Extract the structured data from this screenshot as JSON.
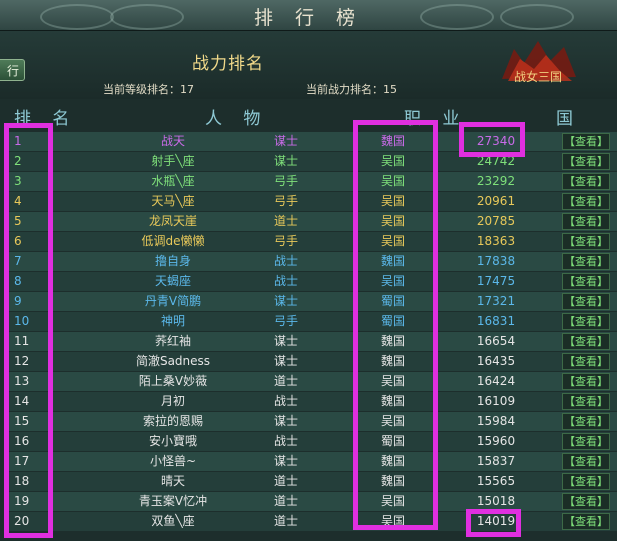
{
  "window": {
    "title": "排 行 榜",
    "side_button": "行"
  },
  "header": {
    "title": "战力排名",
    "level_rank_label": "当前等级排名：17",
    "power_rank_label": "当前战力排名：15",
    "logo_text": "战女三国"
  },
  "columns": {
    "rank": "排 名",
    "person": "人 物",
    "job": "职 业",
    "nation": "国 家"
  },
  "colors": {
    "green": "#7fe07a",
    "yellow": "#e8c95a",
    "blue": "#5bb8ea",
    "white": "#e5e5e5",
    "purple": "#c96be8",
    "highlight": "#e02fe0"
  },
  "rows": [
    {
      "rank": "1",
      "name": "战天",
      "job": "谋士",
      "nation": "魏国",
      "power": "27340",
      "view": "【查看】",
      "color": "#c96be8"
    },
    {
      "rank": "2",
      "name": "射手╲座",
      "job": "谋士",
      "nation": "吴国",
      "power": "24742",
      "view": "【查看】",
      "color": "#7fe07a"
    },
    {
      "rank": "3",
      "name": "水瓶╲座",
      "job": "弓手",
      "nation": "吴国",
      "power": "23292",
      "view": "【查看】",
      "color": "#7fe07a"
    },
    {
      "rank": "4",
      "name": "天马╲座",
      "job": "弓手",
      "nation": "吴国",
      "power": "20961",
      "view": "【查看】",
      "color": "#e8c95a"
    },
    {
      "rank": "5",
      "name": "龙凤天崖",
      "job": "道士",
      "nation": "吴国",
      "power": "20785",
      "view": "【查看】",
      "color": "#e8c95a"
    },
    {
      "rank": "6",
      "name": "低调de懒懒",
      "job": "弓手",
      "nation": "吴国",
      "power": "18363",
      "view": "【查看】",
      "color": "#e8c95a"
    },
    {
      "rank": "7",
      "name": "撸自身",
      "job": "战士",
      "nation": "魏国",
      "power": "17838",
      "view": "【查看】",
      "color": "#5bb8ea"
    },
    {
      "rank": "8",
      "name": "天蝎座",
      "job": "战士",
      "nation": "吴国",
      "power": "17475",
      "view": "【查看】",
      "color": "#5bb8ea"
    },
    {
      "rank": "9",
      "name": "丹青Ⅴ简鹏",
      "job": "谋士",
      "nation": "蜀国",
      "power": "17321",
      "view": "【查看】",
      "color": "#5bb8ea"
    },
    {
      "rank": "10",
      "name": "神明",
      "job": "弓手",
      "nation": "蜀国",
      "power": "16831",
      "view": "【查看】",
      "color": "#5bb8ea"
    },
    {
      "rank": "11",
      "name": "荞红袖",
      "job": "谋士",
      "nation": "魏国",
      "power": "16654",
      "view": "【查看】",
      "color": "#e5e5e5"
    },
    {
      "rank": "12",
      "name": "简澈Sadness",
      "job": "谋士",
      "nation": "魏国",
      "power": "16435",
      "view": "【查看】",
      "color": "#e5e5e5"
    },
    {
      "rank": "13",
      "name": "陌上桑Ⅴ妙薇",
      "job": "道士",
      "nation": "吴国",
      "power": "16424",
      "view": "【查看】",
      "color": "#e5e5e5"
    },
    {
      "rank": "14",
      "name": "月初",
      "job": "战士",
      "nation": "魏国",
      "power": "16109",
      "view": "【查看】",
      "color": "#e5e5e5"
    },
    {
      "rank": "15",
      "name": "索拉的恩赐",
      "job": "谋士",
      "nation": "吴国",
      "power": "15984",
      "view": "【查看】",
      "color": "#e5e5e5"
    },
    {
      "rank": "16",
      "name": "安小寶哦",
      "job": "战士",
      "nation": "蜀国",
      "power": "15960",
      "view": "【查看】",
      "color": "#e5e5e5"
    },
    {
      "rank": "17",
      "name": "小怪兽~",
      "job": "谋士",
      "nation": "魏国",
      "power": "15837",
      "view": "【查看】",
      "color": "#e5e5e5"
    },
    {
      "rank": "18",
      "name": "晴天",
      "job": "道士",
      "nation": "魏国",
      "power": "15565",
      "view": "【查看】",
      "color": "#e5e5e5"
    },
    {
      "rank": "19",
      "name": "青玉案Ⅴ忆冲",
      "job": "道士",
      "nation": "吴国",
      "power": "15018",
      "view": "【查看】",
      "color": "#e5e5e5"
    },
    {
      "rank": "20",
      "name": "双鱼╲座",
      "job": "道士",
      "nation": "吴国",
      "power": "14019",
      "view": "【查看】",
      "color": "#e5e5e5"
    }
  ]
}
